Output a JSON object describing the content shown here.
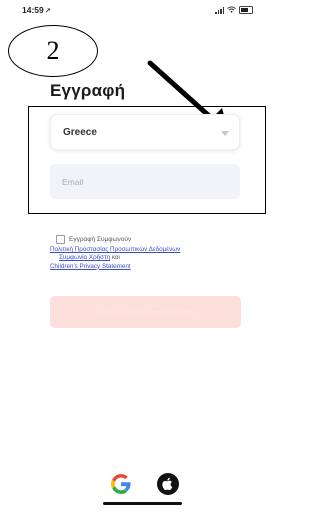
{
  "status_bar": {
    "time": "14:59",
    "location_arrow": "↗"
  },
  "annotation": {
    "step_number": "2"
  },
  "page": {
    "title": "Εγγραφή"
  },
  "form": {
    "country_value": "Greece",
    "email_placeholder": "Email",
    "consent_label": "Εγγραφή Συμφωνούν",
    "privacy_link": "Πολιτική Προστασίας Προσωπικών Δεδομένων",
    "terms_link": "Συμφωνία Χρήστη",
    "and_text": "και",
    "childrens_link": "Children's Privacy Statement",
    "submit_label": "Λήψη κωδικού επαλήθευσης"
  },
  "social_login": {
    "google_icon": "google-icon",
    "apple_icon": "apple-icon"
  },
  "colors": {
    "submit_bg": "#fde0dc",
    "link": "#3a4fc9",
    "email_bg": "#f2f3f8"
  }
}
